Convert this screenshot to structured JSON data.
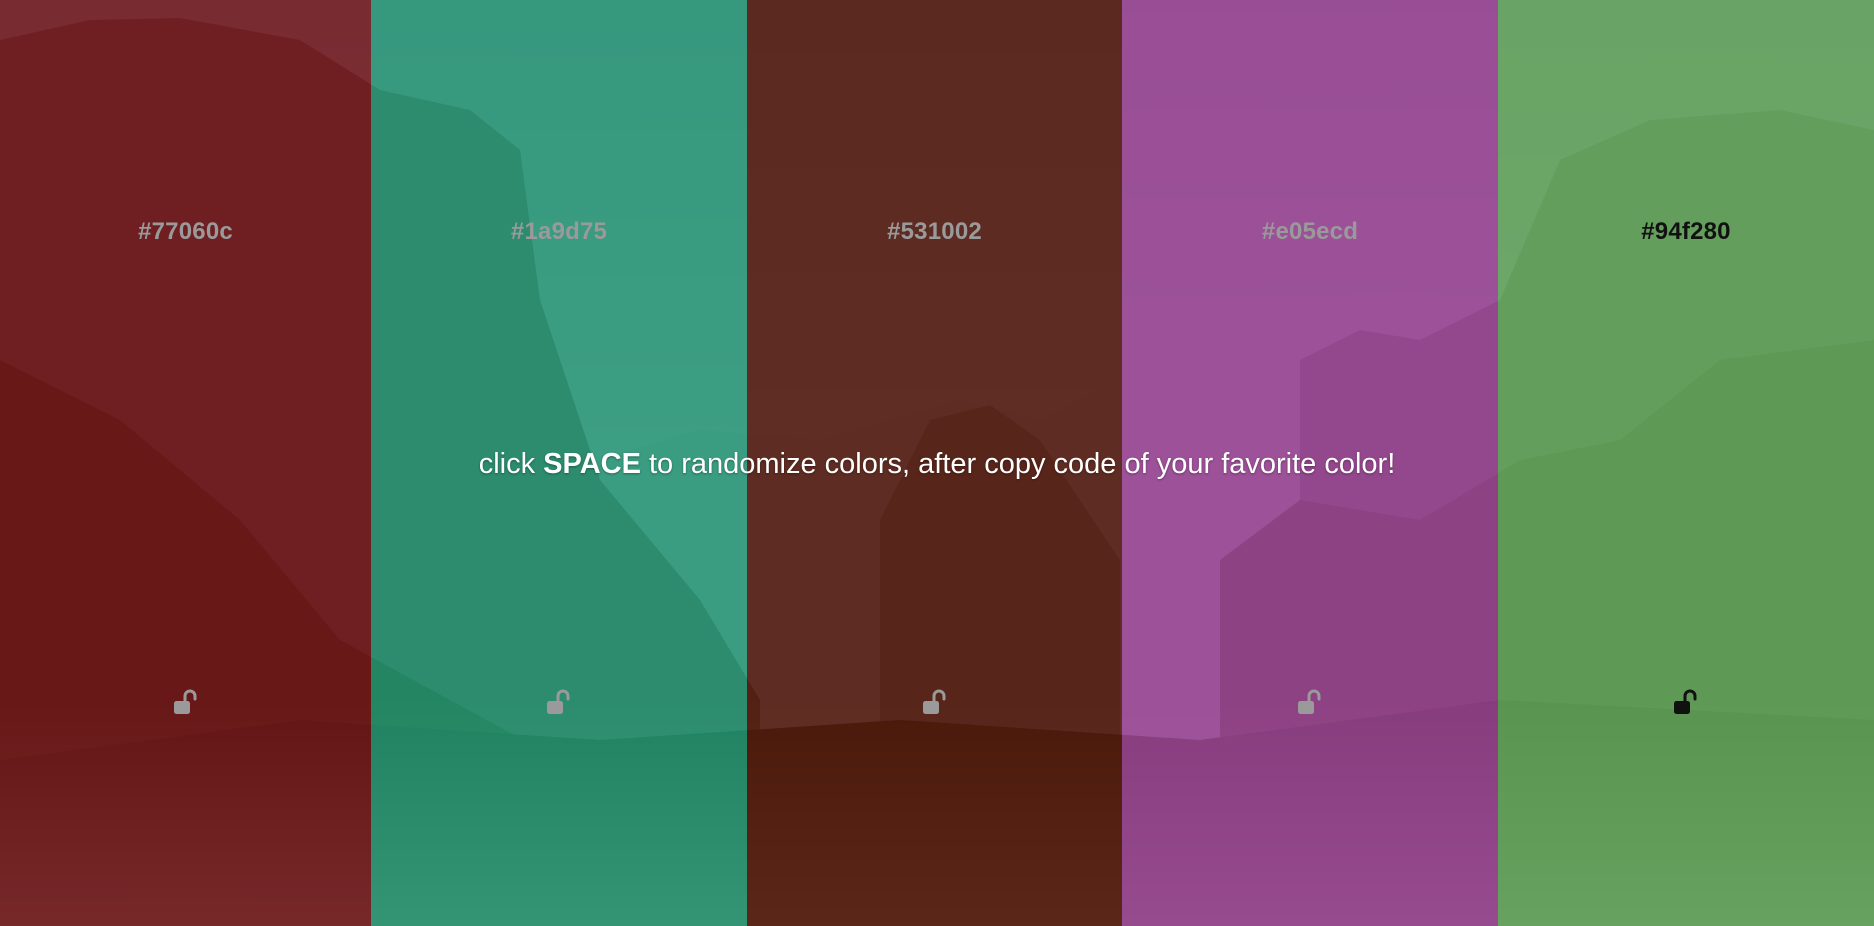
{
  "hint": {
    "prefix": "click ",
    "key": "SPACE",
    "suffix": " to randomize colors, after copy code of your favorite color!"
  },
  "columns": [
    {
      "hex": "#77060c",
      "overlay": "rgba(119,6,12,0.72)",
      "text_color": "#9a9a9a",
      "lock_color": "#9a9a9a",
      "locked": false,
      "icon": "unlock-icon"
    },
    {
      "hex": "#1a9d75",
      "overlay": "rgba(26,157,117,0.72)",
      "text_color": "#9a9a9a",
      "lock_color": "#9a9a9a",
      "locked": false,
      "icon": "unlock-icon"
    },
    {
      "hex": "#531002",
      "overlay": "rgba(83,16,2,0.80)",
      "text_color": "#9a9a9a",
      "lock_color": "#9a9a9a",
      "locked": false,
      "icon": "unlock-icon"
    },
    {
      "hex": "#e05ecd",
      "overlay": "rgba(160,60,150,0.78)",
      "text_color": "#9a9a9a",
      "lock_color": "#9a9a9a",
      "locked": false,
      "icon": "unlock-icon"
    },
    {
      "hex": "#94f280",
      "overlay": "rgba(100,170,90,0.80)",
      "text_color": "#111111",
      "lock_color": "#111111",
      "locked": false,
      "icon": "unlock-icon"
    }
  ]
}
